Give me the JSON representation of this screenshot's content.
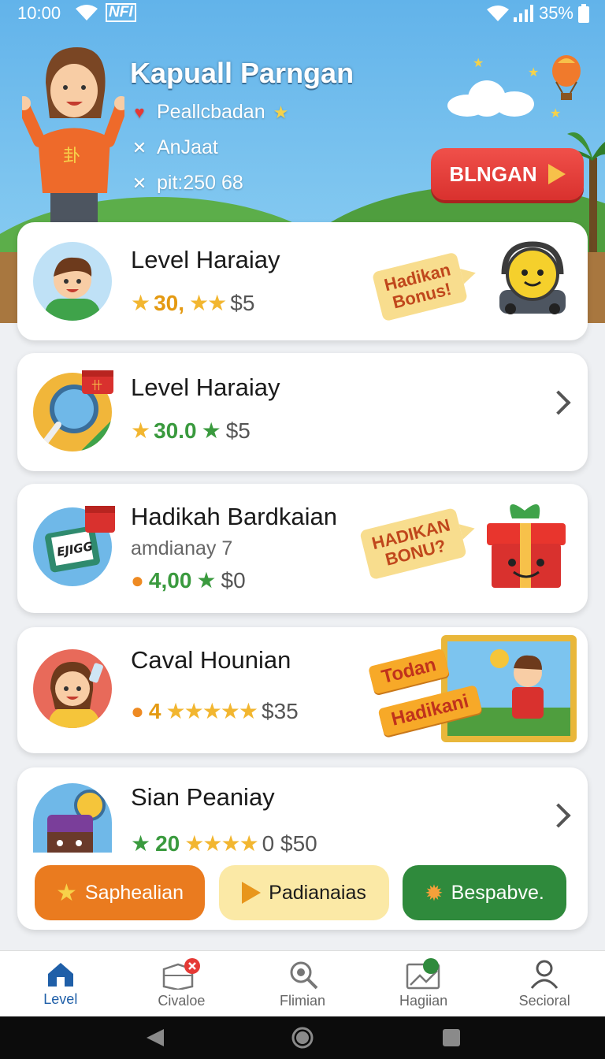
{
  "status_bar": {
    "time": "10:00",
    "nfc": "NFI",
    "battery": "35%"
  },
  "hero": {
    "title": "Kapuall Parngan",
    "line1": "Peallcbadan",
    "line2": "AnJaat",
    "line3": "pit:250 68",
    "cta_label": "BLNGAN"
  },
  "cards": [
    {
      "title": "Level Haraiay",
      "value": "30,",
      "price": "$5",
      "tag": [
        "Hadikan",
        "Bonus!"
      ]
    },
    {
      "title": "Level Haraiay",
      "value": "30.0",
      "price": "$5"
    },
    {
      "title": "Hadikah Bardkaian",
      "subtitle": "amdianay 7",
      "value": "4,00",
      "price": "$0",
      "avatar_text": "EJIGG",
      "tag": [
        "HADIKAN",
        "BONU?"
      ]
    },
    {
      "title": "Caval Hounian",
      "value": "4",
      "price": "$35",
      "tag1": "Todan",
      "tag2": "Hadikani"
    },
    {
      "title": "Sian Peaniay",
      "value": "20",
      "price": "0 $50"
    }
  ],
  "buttons": {
    "primary": "Saphealian",
    "secondary": "Padianaias",
    "tertiary": "Bespabve."
  },
  "bottom_nav": [
    {
      "label": "Level",
      "icon": "home-icon",
      "active": true
    },
    {
      "label": "Civaloe",
      "icon": "box-icon",
      "active": false
    },
    {
      "label": "Flimian",
      "icon": "search-gear-icon",
      "active": false
    },
    {
      "label": "Hagiian",
      "icon": "image-icon",
      "active": false
    },
    {
      "label": "Secioral",
      "icon": "person-icon",
      "active": false
    }
  ],
  "colors": {
    "accent_red": "#d9312e",
    "accent_orange": "#ea7b1f",
    "accent_green": "#3a9a3e",
    "nav_active": "#1f5fa8",
    "sky": "#62b3ea"
  }
}
